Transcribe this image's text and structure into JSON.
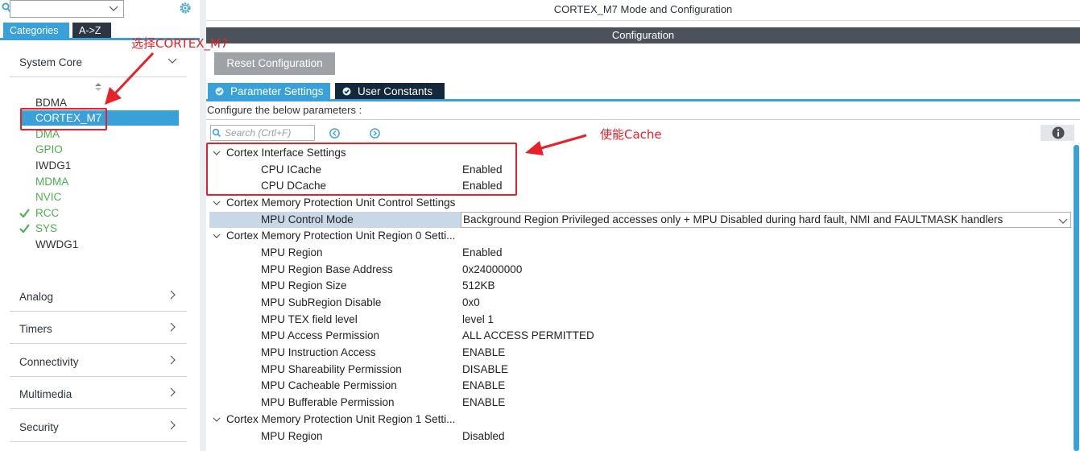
{
  "left_panel": {
    "search": {
      "value": ""
    },
    "tabs": {
      "categories": "Categories",
      "az": "A->Z"
    },
    "categories": {
      "system_core": "System Core",
      "analog": "Analog",
      "timers": "Timers",
      "connectivity": "Connectivity",
      "multimedia": "Multimedia",
      "security": "Security"
    },
    "system_core_items": [
      {
        "label": "BDMA",
        "state": "normal"
      },
      {
        "label": "CORTEX_M7",
        "state": "selected"
      },
      {
        "label": "DMA",
        "state": "available"
      },
      {
        "label": "GPIO",
        "state": "available"
      },
      {
        "label": "IWDG1",
        "state": "normal"
      },
      {
        "label": "MDMA",
        "state": "available"
      },
      {
        "label": "NVIC",
        "state": "available"
      },
      {
        "label": "RCC",
        "state": "configured"
      },
      {
        "label": "SYS",
        "state": "configured"
      },
      {
        "label": "WWDG1",
        "state": "normal"
      }
    ]
  },
  "right_panel": {
    "mode_title": "CORTEX_M7 Mode and Configuration",
    "config_header": "Configuration",
    "reset_button": "Reset Configuration",
    "tabs": {
      "parameter_settings": "Parameter Settings",
      "user_constants": "User Constants"
    },
    "configure_label": "Configure the below parameters :",
    "search_placeholder": "Search (Crtl+F)",
    "groups": {
      "g1": "Cortex Interface Settings",
      "g2": "Cortex Memory Protection Unit Control Settings",
      "g3": "Cortex Memory Protection Unit Region 0 Setti...",
      "g4": "Cortex Memory Protection Unit Region 1 Setti..."
    },
    "params": {
      "icache": {
        "name": "CPU ICache",
        "value": "Enabled"
      },
      "dcache": {
        "name": "CPU DCache",
        "value": "Enabled"
      },
      "mpu_control_mode": {
        "name": "MPU Control Mode",
        "value": "Background Region Privileged accesses only + MPU Disabled during hard fault, NMI and FAULTMASK handlers"
      },
      "r0_region": {
        "name": "MPU Region",
        "value": "Enabled"
      },
      "r0_base": {
        "name": "MPU Region Base Address",
        "value": "0x24000000"
      },
      "r0_size": {
        "name": "MPU Region Size",
        "value": "512KB"
      },
      "r0_subregion": {
        "name": "MPU SubRegion Disable",
        "value": "0x0"
      },
      "r0_tex": {
        "name": "MPU TEX field level",
        "value": "level 1"
      },
      "r0_access": {
        "name": "MPU Access Permission",
        "value": "ALL ACCESS PERMITTED"
      },
      "r0_instr": {
        "name": "MPU Instruction Access",
        "value": "ENABLE"
      },
      "r0_share": {
        "name": "MPU Shareability Permission",
        "value": "DISABLE"
      },
      "r0_cache": {
        "name": "MPU Cacheable Permission",
        "value": "ENABLE"
      },
      "r0_buffer": {
        "name": "MPU Bufferable  Permission",
        "value": "ENABLE"
      },
      "r1_region": {
        "name": "MPU Region",
        "value": "Disabled"
      }
    }
  },
  "annotations": {
    "select_cortex": "选择CORTEX_M7",
    "enable_cache": "使能Cache"
  },
  "colors": {
    "accent_blue": "#39a0d8",
    "dark_header": "#4c5259",
    "annotation_red": "#e8202a",
    "available_green": "#4caf50"
  }
}
